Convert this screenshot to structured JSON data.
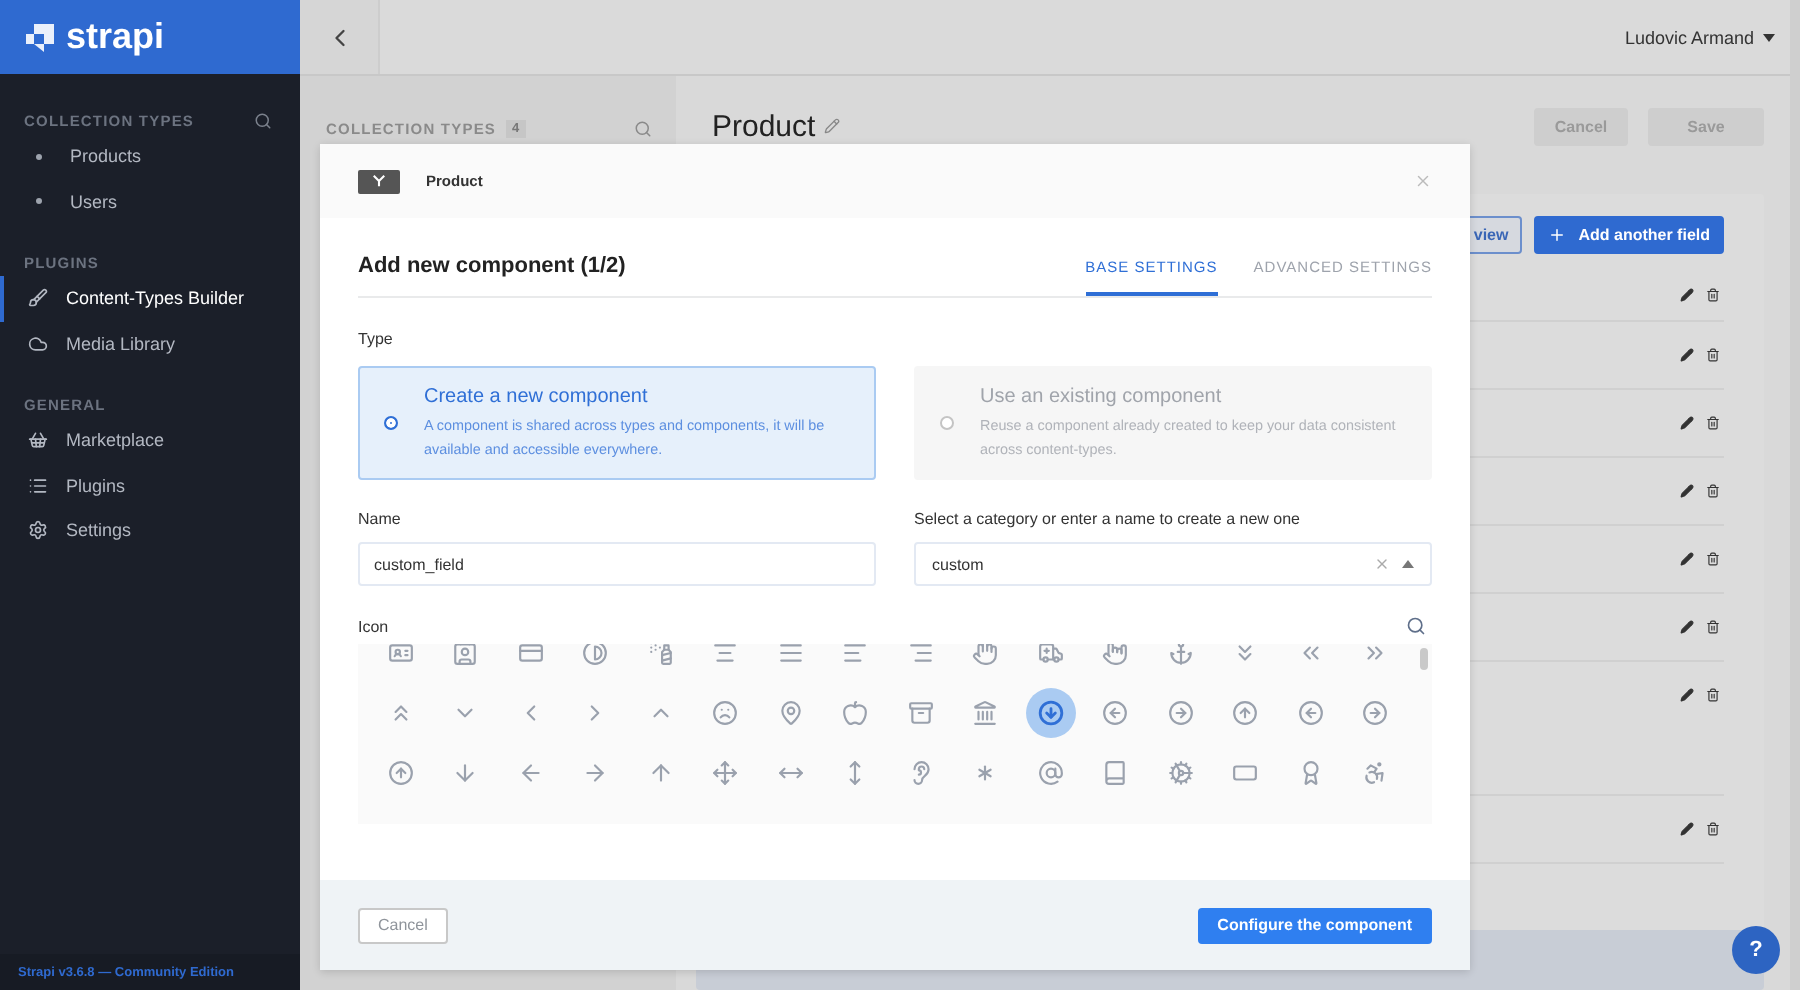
{
  "sidebar": {
    "logo": "strapi",
    "sections": [
      {
        "title": "COLLECTION TYPES",
        "searchable": true,
        "items": [
          {
            "label": "Products",
            "kind": "bullet",
            "selected": false
          },
          {
            "label": "Users",
            "kind": "bullet",
            "selected": false
          }
        ]
      },
      {
        "title": "PLUGINS",
        "searchable": false,
        "items": [
          {
            "label": "Content-Types Builder",
            "kind": "icon",
            "selected": true
          },
          {
            "label": "Media Library",
            "kind": "icon",
            "selected": false
          }
        ]
      },
      {
        "title": "GENERAL",
        "searchable": false,
        "items": [
          {
            "label": "Marketplace",
            "kind": "icon",
            "selected": false
          },
          {
            "label": "Plugins",
            "kind": "icon",
            "selected": false
          },
          {
            "label": "Settings",
            "kind": "icon",
            "selected": false
          }
        ]
      }
    ],
    "footer": "Strapi v3.6.8 — Community Edition"
  },
  "header": {
    "user": "Ludovic Armand"
  },
  "help": "?",
  "secondary_sidebar": {
    "title": "COLLECTION TYPES",
    "count": "4"
  },
  "page": {
    "title": "Product",
    "buttons": [
      {
        "label": "Cancel",
        "disabled": true
      },
      {
        "label": "Save",
        "disabled": true
      }
    ],
    "actions": [
      {
        "label": "view",
        "kind": "secondary"
      },
      {
        "label": "Add another field",
        "kind": "primary"
      }
    ],
    "field_rows": [
      {
        "kind": "field"
      },
      {
        "kind": "field"
      },
      {
        "kind": "field"
      },
      {
        "kind": "field"
      },
      {
        "kind": "field"
      },
      {
        "kind": "field"
      },
      {
        "kind": "group"
      },
      {
        "kind": "field"
      }
    ]
  },
  "modal": {
    "breadcrumb": "Product",
    "title": "Add new component (1/2)",
    "tabs": [
      {
        "label": "BASE SETTINGS",
        "selected": true
      },
      {
        "label": "ADVANCED SETTINGS",
        "selected": false
      }
    ],
    "type_label": "Type",
    "options": [
      {
        "title": "Create a new component",
        "description": "A component is shared across types and components, it will be available and accessible everywhere.",
        "selected": true
      },
      {
        "title": "Use an existing component",
        "description": "Reuse a component already created to keep your data consistent across content-types.",
        "selected": false
      }
    ],
    "name_label": "Name",
    "name_value": "custom_field",
    "category_label": "Select a category or enter a name to create a new one",
    "category_value": "custom",
    "icon_label": "Icon",
    "icons": [
      {
        "selected": false
      },
      {
        "selected": false
      },
      {
        "selected": false
      },
      {
        "selected": false
      },
      {
        "selected": false
      },
      {
        "selected": false
      },
      {
        "selected": false
      },
      {
        "selected": false
      },
      {
        "selected": false
      },
      {
        "selected": false
      },
      {
        "selected": false
      },
      {
        "selected": false
      },
      {
        "selected": false
      },
      {
        "selected": false
      },
      {
        "selected": false
      },
      {
        "selected": false
      },
      {
        "selected": false
      },
      {
        "selected": false
      },
      {
        "selected": false
      },
      {
        "selected": false
      },
      {
        "selected": false
      },
      {
        "selected": false
      },
      {
        "selected": false
      },
      {
        "selected": false
      },
      {
        "selected": false
      },
      {
        "selected": false
      },
      {
        "selected": true
      },
      {
        "selected": false
      },
      {
        "selected": false
      },
      {
        "selected": false
      },
      {
        "selected": false
      },
      {
        "selected": false
      },
      {
        "selected": false
      },
      {
        "selected": false
      },
      {
        "selected": false
      },
      {
        "selected": false
      },
      {
        "selected": false
      },
      {
        "selected": false
      },
      {
        "selected": false
      },
      {
        "selected": false
      },
      {
        "selected": false
      },
      {
        "selected": false
      },
      {
        "selected": false
      },
      {
        "selected": false
      },
      {
        "selected": false
      },
      {
        "selected": false
      },
      {
        "selected": false
      },
      {
        "selected": false
      }
    ],
    "buttons": [
      {
        "label": "Cancel",
        "kind": "secondary"
      },
      {
        "label": "Configure the component",
        "kind": "primary"
      }
    ]
  }
}
